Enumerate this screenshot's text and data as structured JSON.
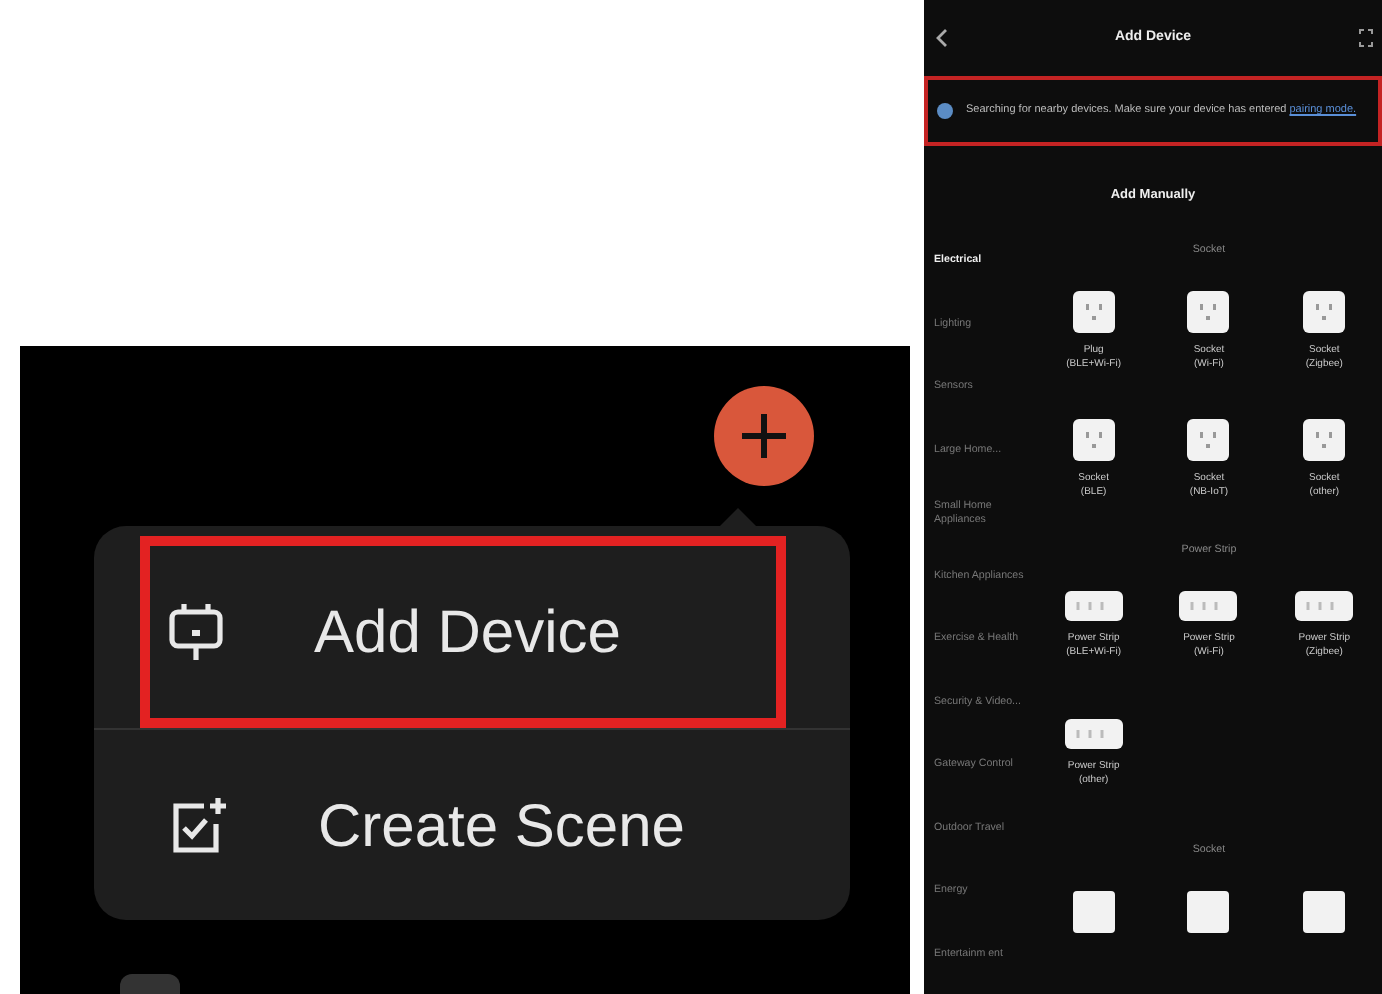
{
  "left_screen": {
    "menu": [
      {
        "label": "Add Device",
        "kind": "device",
        "highlighted": true
      },
      {
        "label": "Create Scene",
        "kind": "scene",
        "highlighted": false
      }
    ]
  },
  "right_screen": {
    "title": "Add Device",
    "banner": {
      "text": "Searching for nearby devices. Make sure your device has entered",
      "link": "pairing mode.",
      "highlighted": true
    },
    "section_title": "Add Manually",
    "categories": [
      {
        "label": "Electrical",
        "selected": true
      },
      {
        "label": "Lighting",
        "selected": false
      },
      {
        "label": "Sensors",
        "selected": false
      },
      {
        "label": "Large Home...",
        "selected": false
      },
      {
        "label": "Small Home Appliances",
        "selected": false
      },
      {
        "label": "Kitchen Appliances",
        "selected": false
      },
      {
        "label": "Exercise & Health",
        "selected": false
      },
      {
        "label": "Security & Video...",
        "selected": false
      },
      {
        "label": "Gateway Control",
        "selected": false
      },
      {
        "label": "Outdoor Travel",
        "selected": false
      },
      {
        "label": "Energy",
        "selected": false
      },
      {
        "label": "Entertainm ent",
        "selected": false
      }
    ],
    "groups": [
      {
        "title": "Socket",
        "items": [
          {
            "kind": "socket",
            "name": "Plug",
            "protocol": "(BLE+Wi-Fi)"
          },
          {
            "kind": "socket",
            "name": "Socket",
            "protocol": "(Wi-Fi)"
          },
          {
            "kind": "socket",
            "name": "Socket",
            "protocol": "(Zigbee)"
          },
          {
            "kind": "socket",
            "name": "Socket",
            "protocol": "(BLE)"
          },
          {
            "kind": "socket",
            "name": "Socket",
            "protocol": "(NB-IoT)"
          },
          {
            "kind": "socket",
            "name": "Socket",
            "protocol": "(other)"
          }
        ]
      },
      {
        "title": "Power Strip",
        "items": [
          {
            "kind": "strip",
            "name": "Power Strip",
            "protocol": "(BLE+Wi-Fi)"
          },
          {
            "kind": "strip",
            "name": "Power Strip",
            "protocol": "(Wi-Fi)"
          },
          {
            "kind": "strip",
            "name": "Power Strip",
            "protocol": "(Zigbee)"
          },
          {
            "kind": "strip",
            "name": "Power Strip",
            "protocol": "(other)"
          }
        ]
      },
      {
        "title": "Socket",
        "items": [
          {
            "kind": "blank"
          },
          {
            "kind": "blank"
          },
          {
            "kind": "blank"
          }
        ]
      }
    ]
  }
}
